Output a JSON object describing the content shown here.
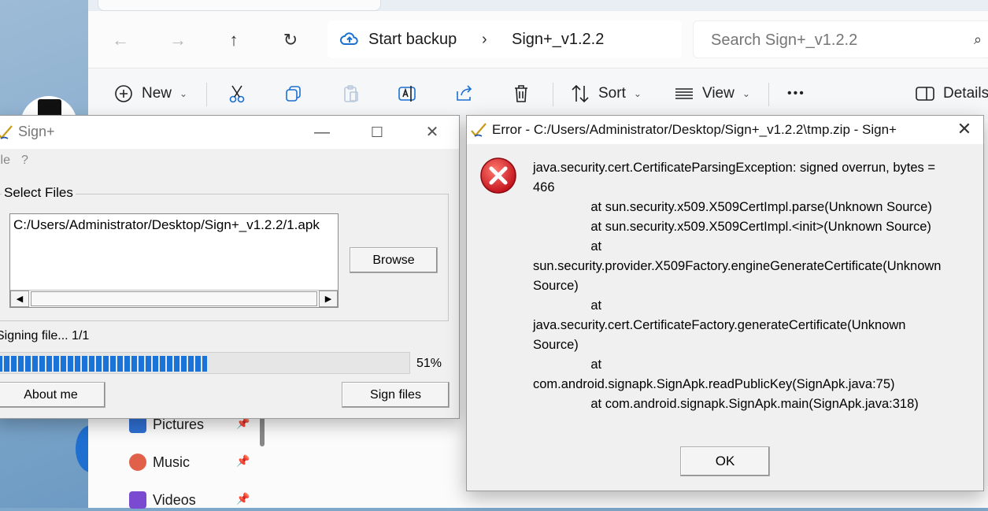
{
  "explorer": {
    "address": {
      "root": "Start backup",
      "folder": "Sign+_v1.2.2"
    },
    "search": {
      "placeholder": "Search Sign+_v1.2.2"
    },
    "toolbar": {
      "new_label": "New",
      "sort_label": "Sort",
      "view_label": "View",
      "more_label": "•••",
      "details_label": "Details"
    },
    "nav_pane": [
      {
        "label": "Pictures",
        "icon": "pictures-icon",
        "color": "#2f6fd1"
      },
      {
        "label": "Music",
        "icon": "music-icon",
        "color": "#e0604a"
      },
      {
        "label": "Videos",
        "icon": "videos-icon",
        "color": "#7a4bd1"
      }
    ]
  },
  "signwin": {
    "title": "Sign+",
    "menu": [
      "ile",
      "?"
    ],
    "group_label": "Select Files",
    "file_path": "C:/Users/Administrator/Desktop/Sign+_v1.2.2/1.apk",
    "browse_label": "Browse",
    "status": "Signing file... 1/1",
    "progress_pct": 51,
    "progress_label": "51%",
    "about_label": "About me",
    "sign_label": "Sign files"
  },
  "error": {
    "title": "Error - C:/Users/Administrator/Desktop/Sign+_v1.2.2\\tmp.zip - Sign+",
    "message": "java.security.cert.CertificateParsingException: signed overrun, bytes =\n466\n                at sun.security.x509.X509CertImpl.parse(Unknown Source)\n                at sun.security.x509.X509CertImpl.<init>(Unknown Source)\n                at\nsun.security.provider.X509Factory.engineGenerateCertificate(Unknown\nSource)\n                at\njava.security.cert.CertificateFactory.generateCertificate(Unknown\nSource)\n                at\ncom.android.signapk.SignApk.readPublicKey(SignApk.java:75)\n                at com.android.signapk.SignApk.main(SignApk.java:318)",
    "ok_label": "OK"
  }
}
